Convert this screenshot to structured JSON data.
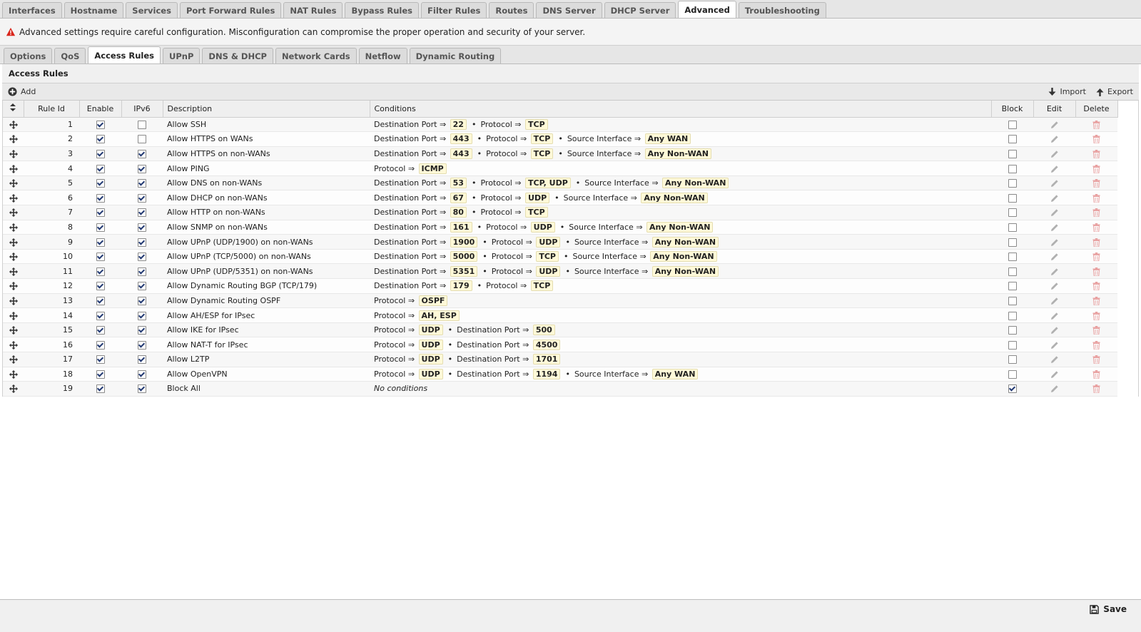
{
  "top_tabs": [
    {
      "label": "Interfaces",
      "active": false
    },
    {
      "label": "Hostname",
      "active": false
    },
    {
      "label": "Services",
      "active": false
    },
    {
      "label": "Port Forward Rules",
      "active": false
    },
    {
      "label": "NAT Rules",
      "active": false
    },
    {
      "label": "Bypass Rules",
      "active": false
    },
    {
      "label": "Filter Rules",
      "active": false
    },
    {
      "label": "Routes",
      "active": false
    },
    {
      "label": "DNS Server",
      "active": false
    },
    {
      "label": "DHCP Server",
      "active": false
    },
    {
      "label": "Advanced",
      "active": true
    },
    {
      "label": "Troubleshooting",
      "active": false
    }
  ],
  "warning": {
    "icon": "warning-icon",
    "text": "Advanced settings require careful configuration. Misconfiguration can compromise the proper operation and security of your server.",
    "color": "#d9261c"
  },
  "sub_tabs": [
    {
      "label": "Options",
      "active": false
    },
    {
      "label": "QoS",
      "active": false
    },
    {
      "label": "Access Rules",
      "active": true
    },
    {
      "label": "UPnP",
      "active": false
    },
    {
      "label": "DNS & DHCP",
      "active": false
    },
    {
      "label": "Network Cards",
      "active": false
    },
    {
      "label": "Netflow",
      "active": false
    },
    {
      "label": "Dynamic Routing",
      "active": false
    }
  ],
  "panel": {
    "title": "Access Rules"
  },
  "toolbar": {
    "add_label": "Add",
    "import_label": "Import",
    "export_label": "Export"
  },
  "columns": {
    "rule_id": "Rule Id",
    "enable": "Enable",
    "ipv6": "IPv6",
    "description": "Description",
    "conditions": "Conditions",
    "block": "Block",
    "edit": "Edit",
    "delete": "Delete"
  },
  "rows": [
    {
      "id": "1",
      "enable": true,
      "ipv6": false,
      "description": "Allow SSH",
      "block": false,
      "conditions": [
        {
          "key": "Destination Port",
          "value": "22"
        },
        {
          "key": "Protocol",
          "value": "TCP"
        }
      ]
    },
    {
      "id": "2",
      "enable": true,
      "ipv6": false,
      "description": "Allow HTTPS on WANs",
      "block": false,
      "conditions": [
        {
          "key": "Destination Port",
          "value": "443"
        },
        {
          "key": "Protocol",
          "value": "TCP"
        },
        {
          "key": "Source Interface",
          "value": "Any WAN"
        }
      ]
    },
    {
      "id": "3",
      "enable": true,
      "ipv6": true,
      "description": "Allow HTTPS on non-WANs",
      "block": false,
      "conditions": [
        {
          "key": "Destination Port",
          "value": "443"
        },
        {
          "key": "Protocol",
          "value": "TCP"
        },
        {
          "key": "Source Interface",
          "value": "Any Non-WAN"
        }
      ]
    },
    {
      "id": "4",
      "enable": true,
      "ipv6": true,
      "description": "Allow PING",
      "block": false,
      "conditions": [
        {
          "key": "Protocol",
          "value": "ICMP"
        }
      ]
    },
    {
      "id": "5",
      "enable": true,
      "ipv6": true,
      "description": "Allow DNS on non-WANs",
      "block": false,
      "conditions": [
        {
          "key": "Destination Port",
          "value": "53"
        },
        {
          "key": "Protocol",
          "value": "TCP, UDP"
        },
        {
          "key": "Source Interface",
          "value": "Any Non-WAN"
        }
      ]
    },
    {
      "id": "6",
      "enable": true,
      "ipv6": true,
      "description": "Allow DHCP on non-WANs",
      "block": false,
      "conditions": [
        {
          "key": "Destination Port",
          "value": "67"
        },
        {
          "key": "Protocol",
          "value": "UDP"
        },
        {
          "key": "Source Interface",
          "value": "Any Non-WAN"
        }
      ]
    },
    {
      "id": "7",
      "enable": true,
      "ipv6": true,
      "description": "Allow HTTP on non-WANs",
      "block": false,
      "conditions": [
        {
          "key": "Destination Port",
          "value": "80"
        },
        {
          "key": "Protocol",
          "value": "TCP"
        }
      ]
    },
    {
      "id": "8",
      "enable": true,
      "ipv6": true,
      "description": "Allow SNMP on non-WANs",
      "block": false,
      "conditions": [
        {
          "key": "Destination Port",
          "value": "161"
        },
        {
          "key": "Protocol",
          "value": "UDP"
        },
        {
          "key": "Source Interface",
          "value": "Any Non-WAN"
        }
      ]
    },
    {
      "id": "9",
      "enable": true,
      "ipv6": true,
      "description": "Allow UPnP (UDP/1900) on non-WANs",
      "block": false,
      "conditions": [
        {
          "key": "Destination Port",
          "value": "1900"
        },
        {
          "key": "Protocol",
          "value": "UDP"
        },
        {
          "key": "Source Interface",
          "value": "Any Non-WAN"
        }
      ]
    },
    {
      "id": "10",
      "enable": true,
      "ipv6": true,
      "description": "Allow UPnP (TCP/5000) on non-WANs",
      "block": false,
      "conditions": [
        {
          "key": "Destination Port",
          "value": "5000"
        },
        {
          "key": "Protocol",
          "value": "TCP"
        },
        {
          "key": "Source Interface",
          "value": "Any Non-WAN"
        }
      ]
    },
    {
      "id": "11",
      "enable": true,
      "ipv6": true,
      "description": "Allow UPnP (UDP/5351) on non-WANs",
      "block": false,
      "conditions": [
        {
          "key": "Destination Port",
          "value": "5351"
        },
        {
          "key": "Protocol",
          "value": "UDP"
        },
        {
          "key": "Source Interface",
          "value": "Any Non-WAN"
        }
      ]
    },
    {
      "id": "12",
      "enable": true,
      "ipv6": true,
      "description": "Allow Dynamic Routing BGP (TCP/179)",
      "block": false,
      "conditions": [
        {
          "key": "Destination Port",
          "value": "179"
        },
        {
          "key": "Protocol",
          "value": "TCP"
        }
      ]
    },
    {
      "id": "13",
      "enable": true,
      "ipv6": true,
      "description": "Allow Dynamic Routing OSPF",
      "block": false,
      "conditions": [
        {
          "key": "Protocol",
          "value": "OSPF"
        }
      ]
    },
    {
      "id": "14",
      "enable": true,
      "ipv6": true,
      "description": "Allow AH/ESP for IPsec",
      "block": false,
      "conditions": [
        {
          "key": "Protocol",
          "value": "AH, ESP"
        }
      ]
    },
    {
      "id": "15",
      "enable": true,
      "ipv6": true,
      "description": "Allow IKE for IPsec",
      "block": false,
      "conditions": [
        {
          "key": "Protocol",
          "value": "UDP"
        },
        {
          "key": "Destination Port",
          "value": "500"
        }
      ]
    },
    {
      "id": "16",
      "enable": true,
      "ipv6": true,
      "description": "Allow NAT-T for IPsec",
      "block": false,
      "conditions": [
        {
          "key": "Protocol",
          "value": "UDP"
        },
        {
          "key": "Destination Port",
          "value": "4500"
        }
      ]
    },
    {
      "id": "17",
      "enable": true,
      "ipv6": true,
      "description": "Allow L2TP",
      "block": false,
      "conditions": [
        {
          "key": "Protocol",
          "value": "UDP"
        },
        {
          "key": "Destination Port",
          "value": "1701"
        }
      ]
    },
    {
      "id": "18",
      "enable": true,
      "ipv6": true,
      "description": "Allow OpenVPN",
      "block": false,
      "conditions": [
        {
          "key": "Protocol",
          "value": "UDP"
        },
        {
          "key": "Destination Port",
          "value": "1194"
        },
        {
          "key": "Source Interface",
          "value": "Any WAN"
        }
      ]
    },
    {
      "id": "19",
      "enable": true,
      "ipv6": true,
      "description": "Block All",
      "block": true,
      "conditions": [],
      "no_conditions_text": "No conditions"
    }
  ],
  "arrow_symbol": "⇒",
  "separator_symbol": "•",
  "footer": {
    "save_label": "Save"
  },
  "colors": {
    "delete_icon": "#e8a0a0",
    "edit_icon": "#b0b0b0",
    "value_bg": "#fff9d8"
  }
}
